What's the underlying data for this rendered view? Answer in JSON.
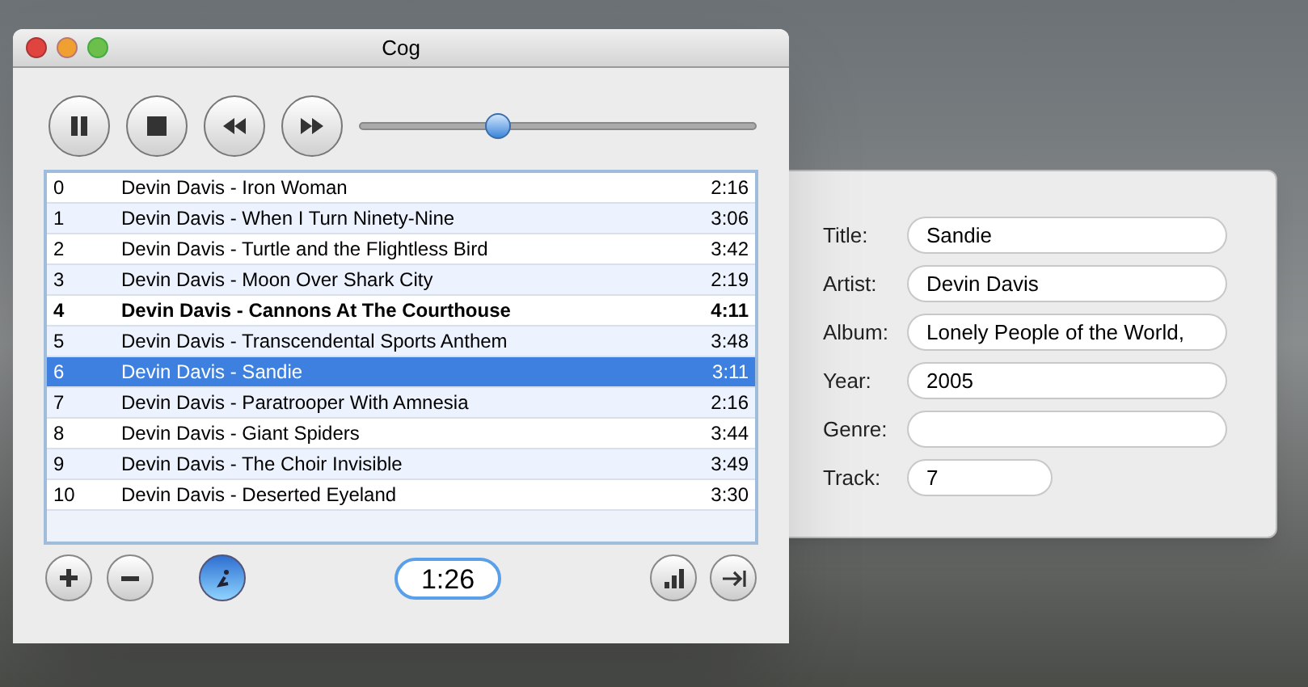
{
  "window": {
    "title": "Cog"
  },
  "controls": {
    "buttons": [
      {
        "kind": "pause"
      },
      {
        "kind": "stop"
      },
      {
        "kind": "rewind"
      },
      {
        "kind": "forward"
      }
    ],
    "seek": {
      "level": 0.35
    }
  },
  "playlist": [
    {
      "index": "0",
      "title": "Devin Davis - Iron Woman",
      "time": "2:16",
      "playing": false,
      "selected": false
    },
    {
      "index": "1",
      "title": "Devin Davis - When I Turn Ninety-Nine",
      "time": "3:06",
      "playing": false,
      "selected": false
    },
    {
      "index": "2",
      "title": "Devin Davis - Turtle and the Flightless Bird",
      "time": "3:42",
      "playing": false,
      "selected": false
    },
    {
      "index": "3",
      "title": "Devin Davis - Moon Over Shark City",
      "time": "2:19",
      "playing": false,
      "selected": false
    },
    {
      "index": "4",
      "title": "Devin Davis - Cannons At The Courthouse",
      "time": "4:11",
      "playing": true,
      "selected": false
    },
    {
      "index": "5",
      "title": "Devin Davis - Transcendental Sports Anthem",
      "time": "3:48",
      "playing": false,
      "selected": false
    },
    {
      "index": "6",
      "title": "Devin Davis - Sandie",
      "time": "3:11",
      "playing": false,
      "selected": true
    },
    {
      "index": "7",
      "title": "Devin Davis - Paratrooper With Amnesia",
      "time": "2:16",
      "playing": false,
      "selected": false
    },
    {
      "index": "8",
      "title": "Devin Davis - Giant Spiders",
      "time": "3:44",
      "playing": false,
      "selected": false
    },
    {
      "index": "9",
      "title": "Devin Davis - The Choir Invisible",
      "time": "3:49",
      "playing": false,
      "selected": false
    },
    {
      "index": "10",
      "title": "Devin Davis - Deserted Eyeland",
      "time": "3:30",
      "playing": false,
      "selected": false
    }
  ],
  "bottom_bar": {
    "elapsed": "1:26"
  },
  "info_drawer": {
    "fields": [
      {
        "label": "Title:",
        "value": "Sandie",
        "kind": "wide"
      },
      {
        "label": "Artist:",
        "value": "Devin Davis",
        "kind": "wide"
      },
      {
        "label": "Album:",
        "value": "Lonely People of the World,",
        "kind": "wide"
      },
      {
        "label": "Year:",
        "value": "2005",
        "kind": "wide"
      },
      {
        "label": "Genre:",
        "kind": "wide"
      },
      {
        "label": "Track:",
        "value": "7",
        "kind": "short"
      }
    ]
  }
}
